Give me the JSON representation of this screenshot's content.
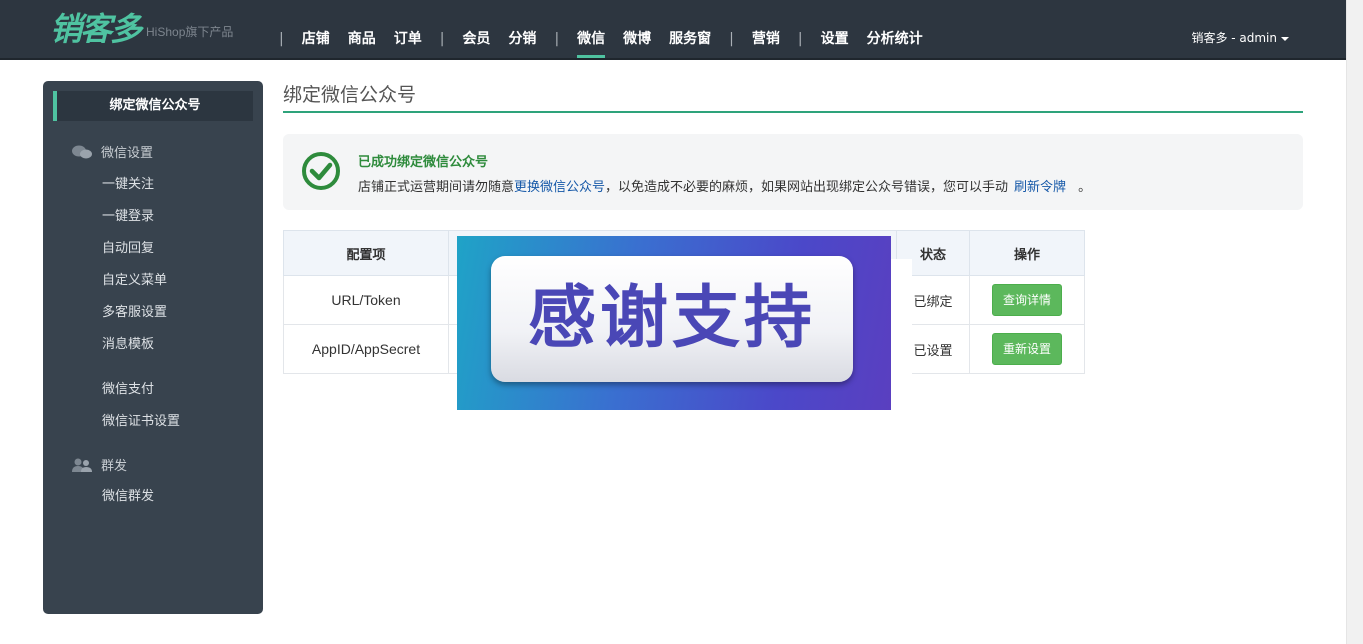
{
  "header": {
    "logo_text": "销客多",
    "logo_sub": "HiShop旗下产品",
    "nav": [
      "店铺",
      "商品",
      "订单",
      "会员",
      "分销",
      "微信",
      "微博",
      "服务窗",
      "营销",
      "设置",
      "分析统计"
    ],
    "active_nav": "微信",
    "user": "销客多 - admin"
  },
  "sidebar": {
    "current": "绑定微信公众号",
    "groups": [
      {
        "label": "微信设置",
        "icon": "wechat-icon"
      },
      {
        "label": "群发",
        "icon": "users-icon"
      }
    ],
    "links": [
      "一键关注",
      "一键登录",
      "自动回复",
      "自定义菜单",
      "多客服设置",
      "消息模板",
      "微信支付",
      "微信证书设置",
      "微信群发"
    ]
  },
  "main": {
    "title": "绑定微信公众号",
    "alert": {
      "title": "已成功绑定微信公众号",
      "text_prefix": "店铺正式运营期间请勿随意",
      "link_change": "更换微信公众号",
      "text_middle": "，以免造成不必要的麻烦，如果网站出现绑定公众号错误，您可以手动",
      "link_refresh": "刷新令牌",
      "text_suffix": "。"
    },
    "table": {
      "headers": [
        "配置项",
        "状态",
        "操作"
      ],
      "rows": [
        {
          "item": "URL/Token",
          "status": "已绑定",
          "action": "查询详情"
        },
        {
          "item": "AppID/AppSecret",
          "status": "已设置",
          "action": "重新设置"
        }
      ]
    },
    "banner_text": "感谢支持"
  },
  "colors": {
    "topbar": "#2d3640",
    "accent": "#4fc3a1",
    "sidebar": "#38434e",
    "success_green": "#2e8b3c",
    "button_green": "#5cb85c",
    "link_blue": "#1558a8"
  }
}
